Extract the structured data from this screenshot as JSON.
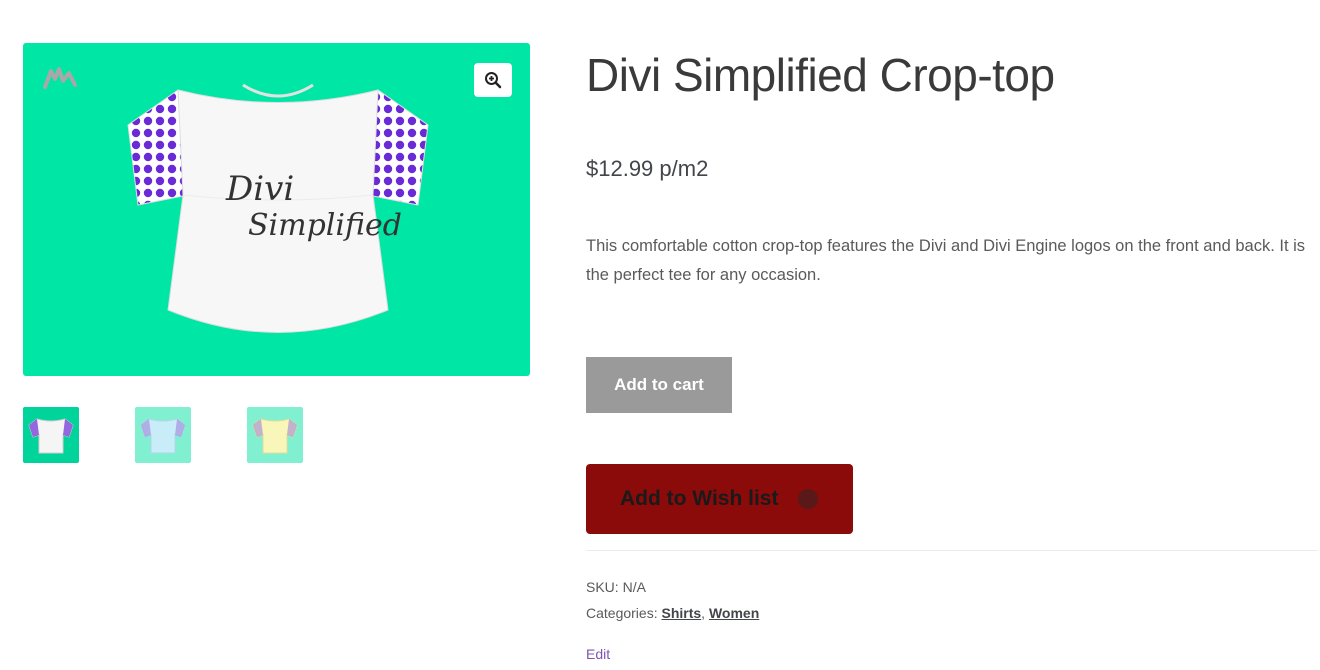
{
  "product": {
    "title": "Divi Simplified Crop-top",
    "price": "$12.99 p/m2",
    "description": "This comfortable cotton crop-top features the Divi and Divi Engine logos on the front and back. It is the perfect tee for any occasion.",
    "add_to_cart_label": "Add to cart",
    "wishlist_label": "Add to Wish list",
    "sku_label": "SKU:",
    "sku_value": "N/A",
    "categories_label": "Categories:",
    "categories": [
      "Shirts",
      "Women"
    ],
    "category_separator": ",",
    "edit_label": "Edit"
  },
  "gallery": {
    "main_image_bg": "#00e6a5",
    "shirt_print_line1": "Divi",
    "shirt_print_line2": "Simplified",
    "zoom_icon": "zoom-in-icon",
    "thumbnails": [
      {
        "variant": "white",
        "bg": "#00d49a"
      },
      {
        "variant": "blue",
        "bg": "#80f0d0"
      },
      {
        "variant": "yellow",
        "bg": "#80f0d0"
      }
    ]
  },
  "colors": {
    "accent_wishlist": "#8b0a0a",
    "add_to_cart_bg": "#9a9a9a",
    "edit_link": "#7f54b3"
  }
}
